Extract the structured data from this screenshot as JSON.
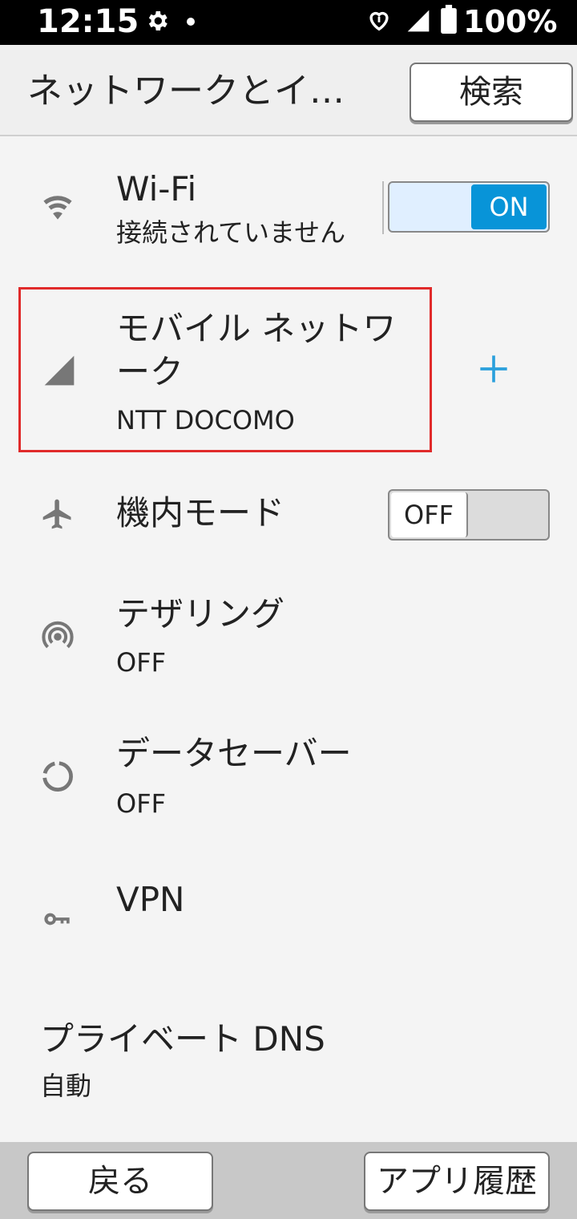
{
  "status_bar": {
    "time": "12:15",
    "battery": "100%",
    "icons": [
      "settings-gear-icon",
      "notification-dot-icon",
      "heart-signal-icon",
      "cell-signal-icon",
      "battery-icon"
    ]
  },
  "app_bar": {
    "title": "ネットワークとイ…",
    "search_label": "検索"
  },
  "settings": {
    "wifi": {
      "title": "Wi-Fi",
      "subtitle": "接続されていません",
      "toggle": "ON",
      "icon": "wifi-icon"
    },
    "mobile": {
      "title_line1": "モバイル ネットワ",
      "title_line2": "ーク",
      "subtitle": "NTT DOCOMO",
      "icon": "cell-signal-icon",
      "action_icon": "plus-icon"
    },
    "airplane": {
      "title": "機内モード",
      "toggle": "OFF",
      "icon": "airplane-icon"
    },
    "tethering": {
      "title": "テザリング",
      "subtitle": "OFF",
      "icon": "hotspot-icon"
    },
    "datasaver": {
      "title": "データセーバー",
      "subtitle": "OFF",
      "icon": "data-saver-icon"
    },
    "vpn": {
      "title": "VPN",
      "icon": "key-icon"
    },
    "dns": {
      "title": "プライベート DNS",
      "subtitle": "自動"
    }
  },
  "bottom_bar": {
    "back_label": "戻る",
    "history_label": "アプリ履歴"
  },
  "colors": {
    "accent": "#0894d8",
    "highlight": "#e02a2a"
  }
}
